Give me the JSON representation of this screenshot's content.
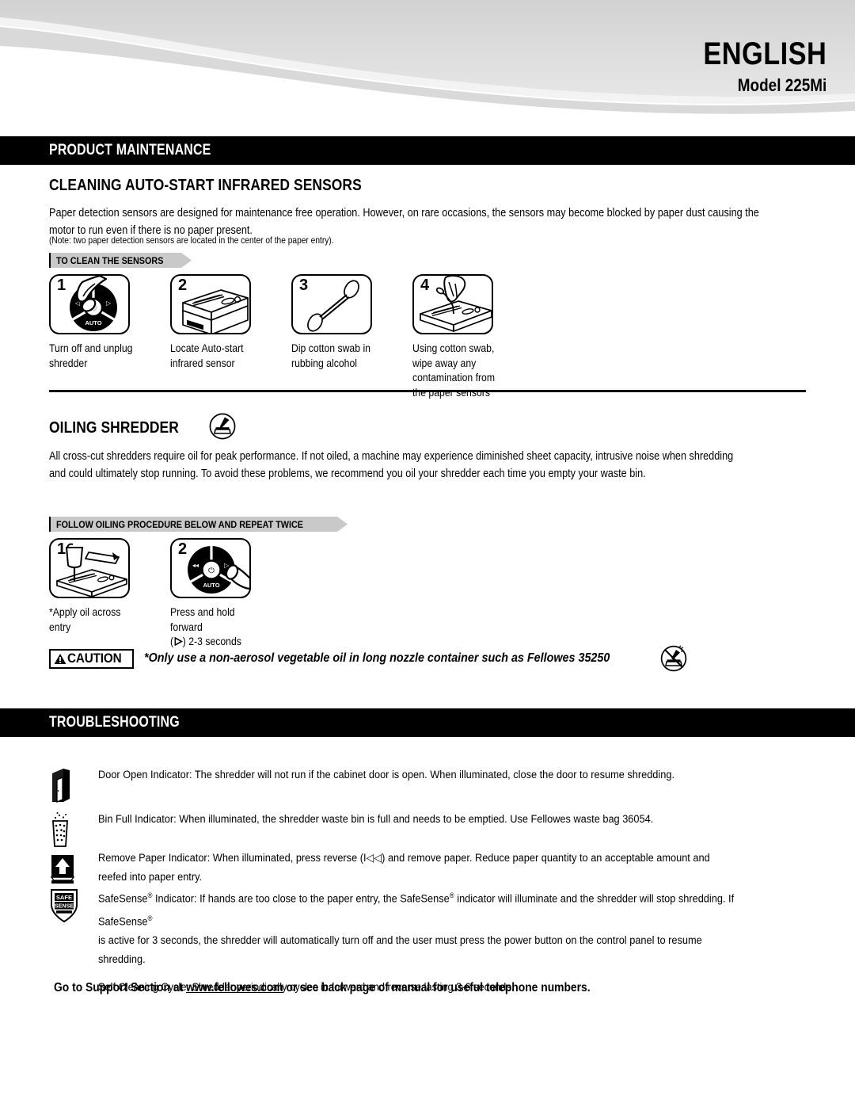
{
  "header": {
    "language_title": "ENGLISH",
    "model_title": "Model 225Mi"
  },
  "sections": {
    "product_maintenance": {
      "bar_label": "PRODUCT MAINTENANCE",
      "heading": "CLEANING AUTO-START INFRARED SENSORS",
      "body": "Paper detection sensors are designed for maintenance free operation. However, on rare occasions, the sensors may become blocked by paper dust causing the motor to run even if there is no paper present.",
      "note": "(Note: two paper detection sensors are located in the center of the paper entry).",
      "tag_label": "TO CLEAN THE SENSORS",
      "steps": [
        {
          "number": "1",
          "caption": "Turn off and unplug shredder",
          "icon": "control-panel-power-icon"
        },
        {
          "number": "2",
          "caption": "Locate Auto-start infrared sensor",
          "icon": "shredder-machine-icon"
        },
        {
          "number": "3",
          "caption": "Dip cotton swab in rubbing alcohol",
          "icon": "cotton-swab-icon"
        },
        {
          "number": "4",
          "caption": "Using cotton swab, wipe away any contamination from the paper sensors",
          "icon": "hand-wiping-sensor-icon"
        }
      ]
    },
    "oiling_shredder": {
      "heading": "OILING SHREDDER",
      "heading_icon": "oil-bottle-icon",
      "body": "All cross-cut shredders require oil for peak performance. If not oiled, a machine may experience diminished sheet capacity, intrusive noise when shredding and could ultimately stop running. To avoid these problems, we recommend you oil your shredder each time you empty your waste bin.",
      "tag_label": "FOLLOW OILING PROCEDURE BELOW AND REPEAT TWICE",
      "steps": [
        {
          "number": "1",
          "caption": "*Apply oil across entry",
          "icon": "oil-bottle-over-entry-icon"
        },
        {
          "number": "2",
          "caption_line1": "Press and hold forward",
          "caption_line2_pre": "(",
          "caption_line2_post": ") 2-3 seconds",
          "icon": "control-panel-forward-icon"
        }
      ],
      "caution": {
        "label": "CAUTION",
        "message": "*Only use a non-aerosol vegetable oil in long nozzle container such as Fellowes 35250",
        "icon": "no-aerosol-oil-icon"
      }
    },
    "troubleshooting": {
      "bar_label": "TROUBLESHOOTING",
      "items": [
        {
          "icon": "door-open-indicator-icon",
          "text": "Door Open Indicator:  The shredder will not run if the cabinet door is open.  When illuminated, close the door to resume shredding."
        },
        {
          "icon": "bin-full-indicator-icon",
          "text": "Bin Full Indicator: When illuminated, the shredder waste bin is full and needs to be emptied.  Use Fellowes waste bag 36054."
        },
        {
          "icon": "remove-paper-indicator-icon",
          "text_pre": "Remove Paper Indicator:  When illuminated, press reverse (",
          "text_reverse_symbol": "I◁◁",
          "text_post": ") and remove paper.  Reduce paper quantity to an acceptable amount and reefed into paper entry."
        },
        {
          "icon": "safesense-indicator-icon",
          "badge_line1": "SAFE",
          "badge_line2": "SENSE",
          "text_line1_a": "SafeSense",
          "text_line1_b": " Indicator:  If hands are too close to the paper entry, the SafeSense",
          "text_line1_c": " indicator will illuminate and the shredder will stop shredding.  If SafeSense",
          "text_line2": "is active for 3 seconds, the shredder will automatically turn off and the user must press the power button on the control panel to resume shredding.",
          "text_line3": "Self Cleaning Cycle: Shredder periodically cycles in forward and reverse lasting 3-6 seconds."
        }
      ]
    }
  },
  "footer": {
    "text_pre": "Go to Support Section at ",
    "link": "www.fellowes.com",
    "text_post": " or see back page of manual for useful telephone numbers."
  },
  "colors": {
    "bar_background": "#000000",
    "bar_text": "#ffffff",
    "tag_background": "#c9c9c9",
    "page_background": "#ffffff",
    "ink": "#000000"
  }
}
